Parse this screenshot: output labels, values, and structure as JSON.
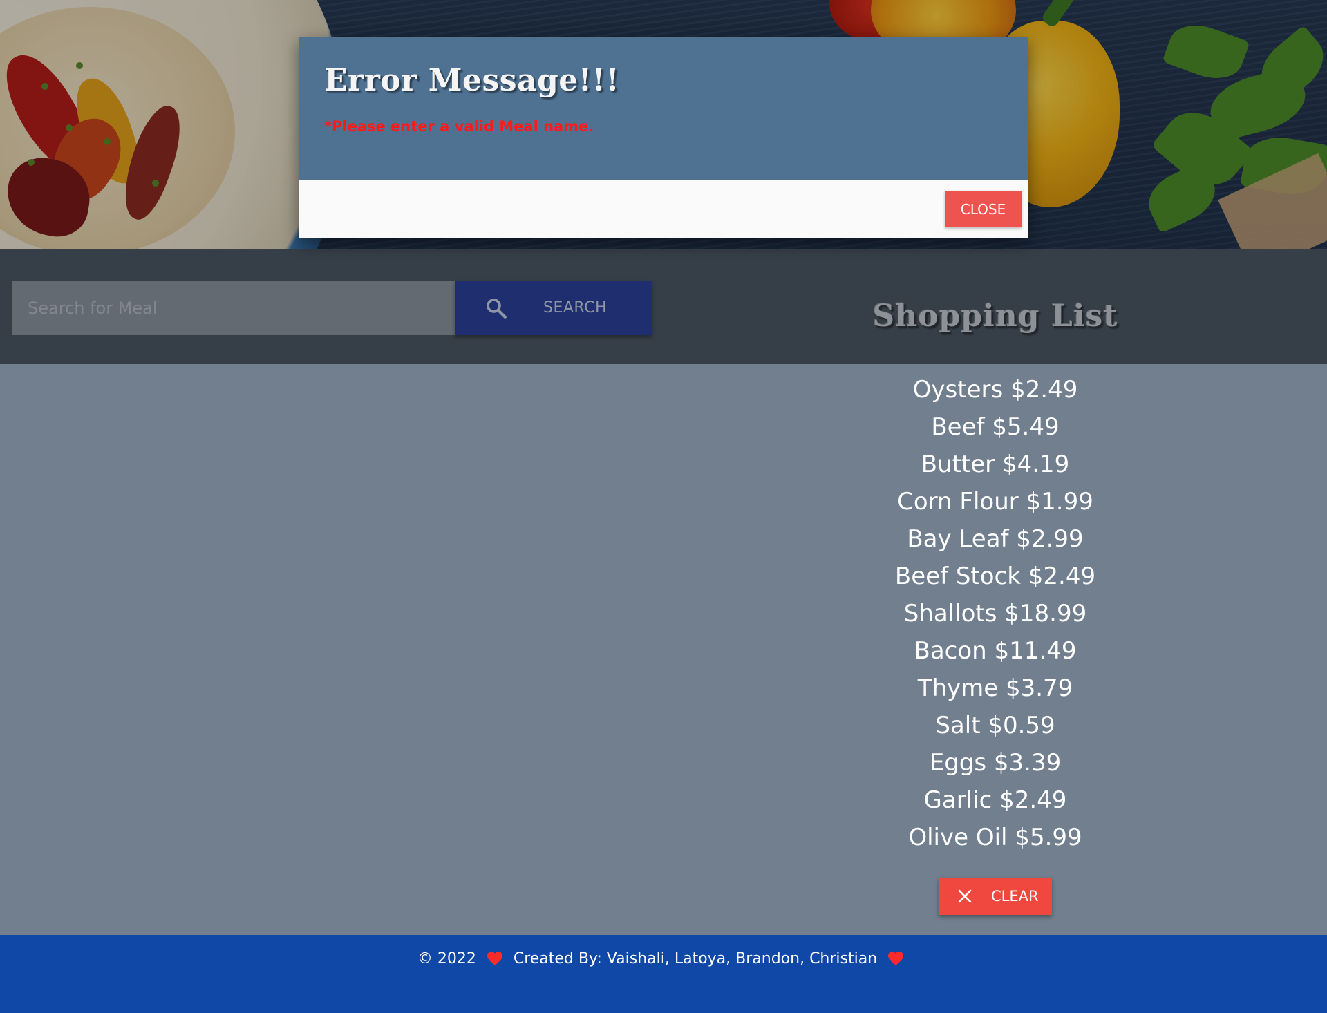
{
  "modal": {
    "title": "Error Message!!!",
    "message": "*Please enter a valid Meal name.",
    "close_label": "CLOSE"
  },
  "search": {
    "placeholder": "Search for Meal",
    "value": "",
    "button_label": "SEARCH",
    "button_icon": "search-icon"
  },
  "shopping_list": {
    "title": "Shopping List",
    "items": [
      "Oysters $2.49",
      "Beef $5.49",
      "Butter $4.19",
      "Corn Flour $1.99",
      "Bay Leaf $2.99",
      "Beef Stock $2.49",
      "Shallots $18.99",
      "Bacon $11.49",
      "Thyme $3.79",
      "Salt $0.59",
      "Eggs $3.39",
      "Garlic $2.49",
      "Olive Oil $5.99"
    ],
    "clear_label": "CLEAR",
    "clear_icon": "close-icon"
  },
  "footer": {
    "copyright": "© 2022",
    "credits": "Created By: Vaishali, Latoya, Brandon, Christian",
    "icon": "heart-icon"
  },
  "colors": {
    "modal_header": "#4f7293",
    "error_text": "#ff1a1a",
    "danger_button": "#f0473f",
    "search_button": "#1f2e6e",
    "footer": "#0f48a6",
    "page_background": "#717f8f"
  }
}
